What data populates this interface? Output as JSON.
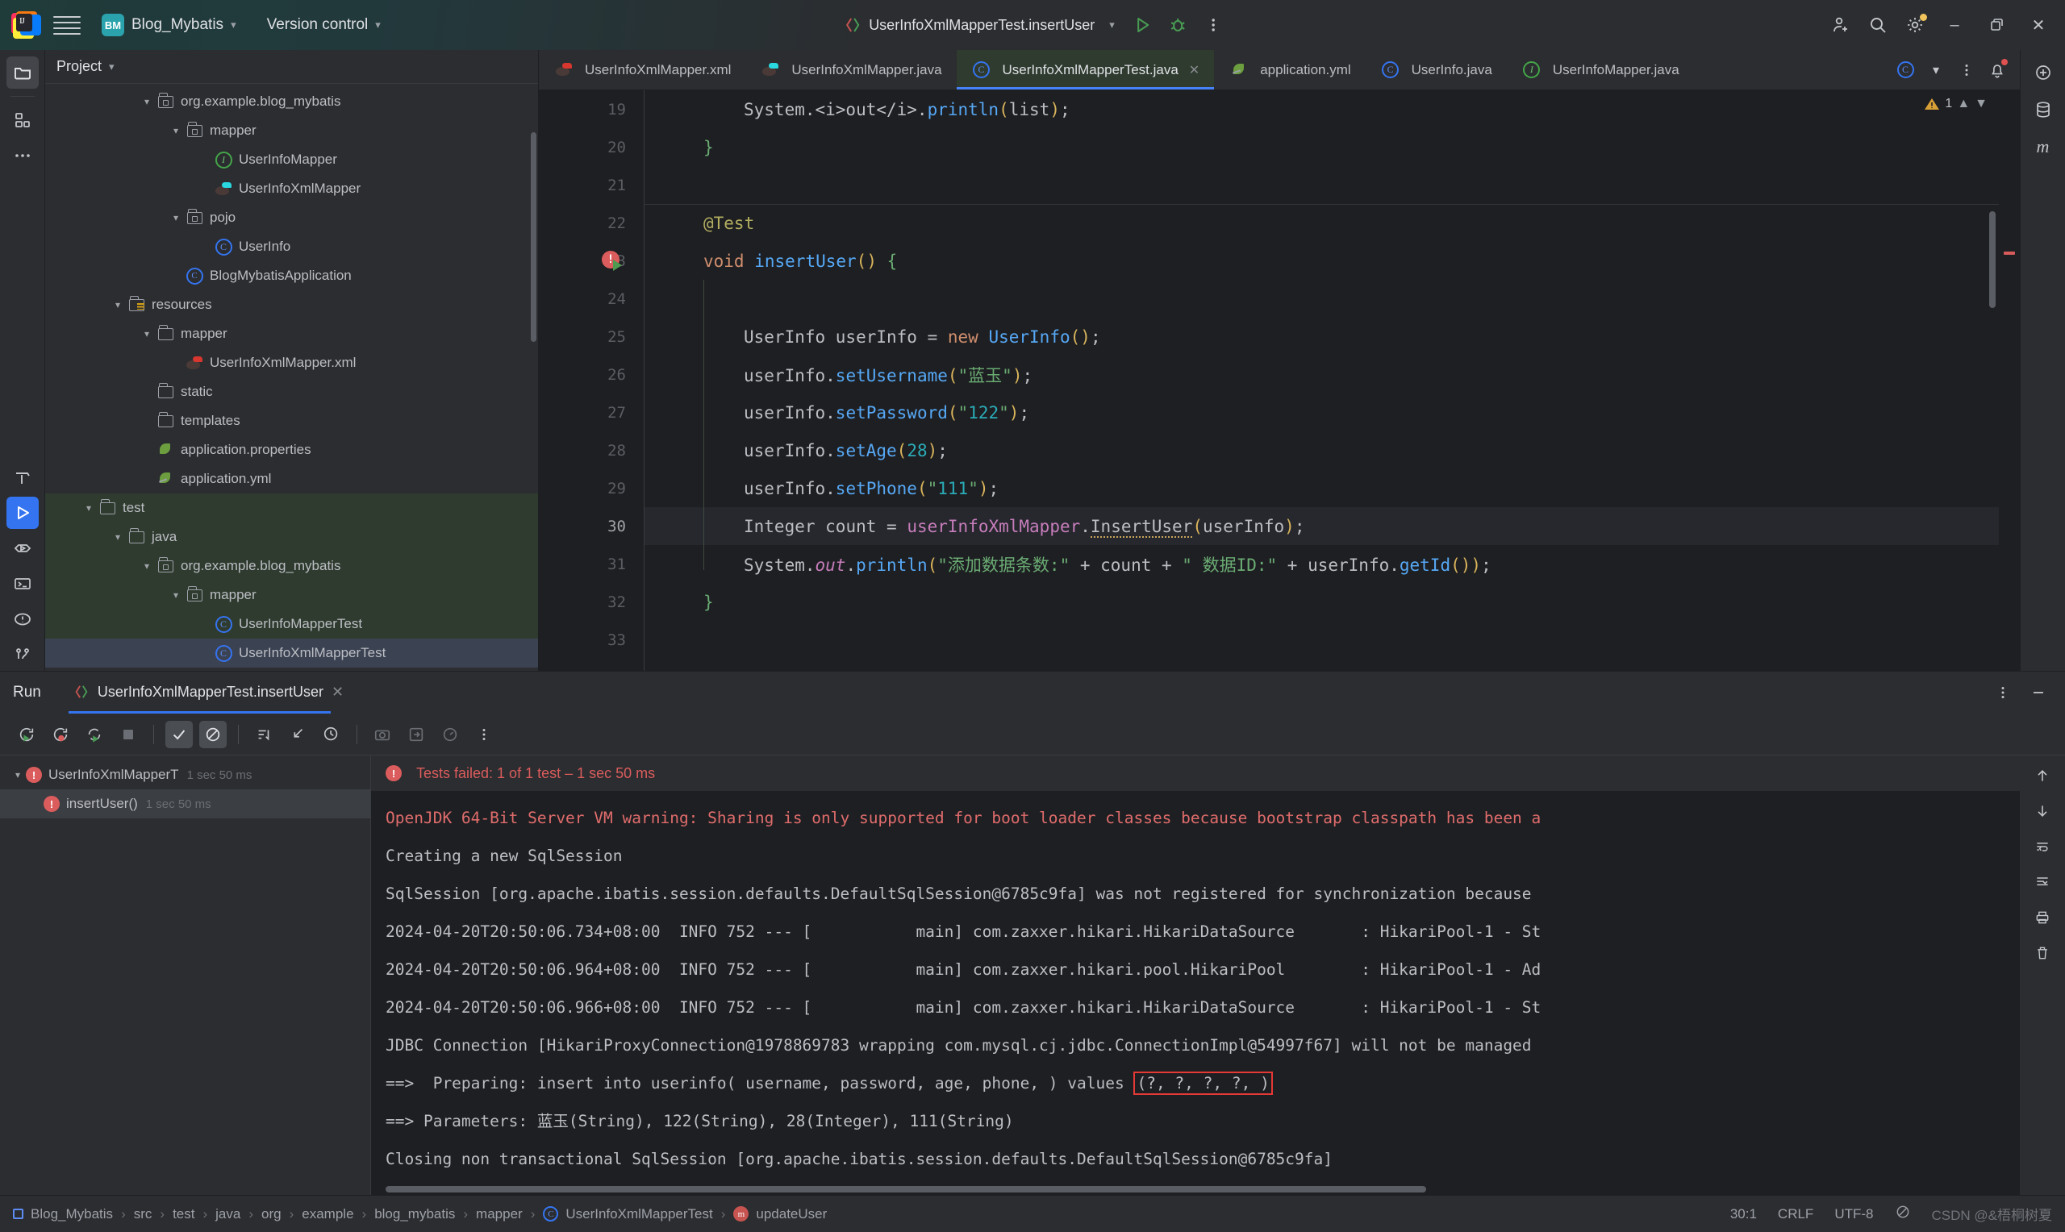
{
  "titlebar": {
    "logo_icon": "intellij-idea-logo",
    "menu_icon": "hamburger-menu-icon",
    "project_badge": "BM",
    "project_name": "Blog_Mybatis",
    "version_control": "Version control",
    "run_config": "UserInfoXmlMapperTest.insertUser",
    "run_icon": "run-icon",
    "debug_icon": "debug-icon",
    "more_icon": "more-vertical-icon",
    "account_icon": "add-account-icon",
    "search_icon": "search-icon",
    "settings_icon": "gear-icon",
    "minimize": "–",
    "maximize": "❐",
    "close": "✕"
  },
  "left_rail": [
    {
      "name": "project-tool-window",
      "icon": "folder-icon",
      "active": true
    },
    {
      "name": "structure-tool-window",
      "icon": "structure-icon",
      "active": false
    },
    {
      "name": "more-tool-windows",
      "icon": "ellipsis-icon",
      "active": false
    }
  ],
  "left_rail_bottom": [
    {
      "name": "build-tool-window",
      "icon": "hammer-icon",
      "active": false
    },
    {
      "name": "run-tool-window",
      "icon": "run-triangle-icon",
      "active": true
    },
    {
      "name": "debug-tool-window",
      "icon": "debug-eye-icon",
      "active": false
    },
    {
      "name": "terminal-tool-window",
      "icon": "terminal-icon",
      "active": false
    },
    {
      "name": "problems-tool-window",
      "icon": "warning-circle-icon",
      "active": false
    },
    {
      "name": "git-tool-window",
      "icon": "git-branch-icon",
      "active": false
    }
  ],
  "right_rail": [
    {
      "name": "ai-assistant",
      "icon": "ai-icon"
    },
    {
      "name": "database",
      "icon": "database-icon"
    },
    {
      "name": "maven",
      "icon": "maven-m-icon"
    }
  ],
  "project_panel": {
    "title": "Project",
    "tree": [
      {
        "depth": 3,
        "arrow": "down",
        "icon": "package-folder-icon",
        "label": "org.example.blog_mybatis",
        "kind": "folder"
      },
      {
        "depth": 4,
        "arrow": "down",
        "icon": "package-folder-icon",
        "label": "mapper",
        "kind": "folder"
      },
      {
        "depth": 5,
        "arrow": "none",
        "icon": "interface-icon",
        "label": "UserInfoMapper",
        "kind": "interface"
      },
      {
        "depth": 5,
        "arrow": "none",
        "icon": "mybatis-icon-cyan",
        "label": "UserInfoXmlMapper",
        "kind": "mybatis"
      },
      {
        "depth": 4,
        "arrow": "down",
        "icon": "package-folder-icon",
        "label": "pojo",
        "kind": "folder"
      },
      {
        "depth": 5,
        "arrow": "none",
        "icon": "class-icon",
        "label": "UserInfo",
        "kind": "class"
      },
      {
        "depth": 4,
        "arrow": "none",
        "icon": "spring-boot-icon",
        "label": "BlogMybatisApplication",
        "kind": "spring"
      },
      {
        "depth": 2,
        "arrow": "down",
        "icon": "resources-folder-icon",
        "label": "resources",
        "kind": "folder"
      },
      {
        "depth": 3,
        "arrow": "down",
        "icon": "folder-icon",
        "label": "mapper",
        "kind": "folder"
      },
      {
        "depth": 4,
        "arrow": "none",
        "icon": "mybatis-icon-red",
        "label": "UserInfoXmlMapper.xml",
        "kind": "mybatis"
      },
      {
        "depth": 3,
        "arrow": "none",
        "icon": "folder-icon",
        "label": "static",
        "kind": "folder"
      },
      {
        "depth": 3,
        "arrow": "none",
        "icon": "folder-icon",
        "label": "templates",
        "kind": "folder"
      },
      {
        "depth": 3,
        "arrow": "none",
        "icon": "properties-icon",
        "label": "application.properties",
        "kind": "file"
      },
      {
        "depth": 3,
        "arrow": "none",
        "icon": "yaml-icon",
        "label": "application.yml",
        "kind": "file"
      },
      {
        "depth": 1,
        "arrow": "down",
        "icon": "folder-icon",
        "label": "test",
        "kind": "folder",
        "highlight": "green"
      },
      {
        "depth": 2,
        "arrow": "down",
        "icon": "folder-icon",
        "label": "java",
        "kind": "folder",
        "highlight": "green"
      },
      {
        "depth": 3,
        "arrow": "down",
        "icon": "package-folder-icon",
        "label": "org.example.blog_mybatis",
        "kind": "folder",
        "highlight": "green"
      },
      {
        "depth": 4,
        "arrow": "down",
        "icon": "package-folder-icon",
        "label": "mapper",
        "kind": "folder",
        "highlight": "green"
      },
      {
        "depth": 5,
        "arrow": "none",
        "icon": "class-icon",
        "label": "UserInfoMapperTest",
        "kind": "class",
        "highlight": "green"
      },
      {
        "depth": 5,
        "arrow": "none",
        "icon": "class-icon",
        "label": "UserInfoXmlMapperTest",
        "kind": "class",
        "highlight": "selected"
      }
    ]
  },
  "editor": {
    "tabs": [
      {
        "label": "UserInfoXmlMapper.xml",
        "icon": "mybatis-icon-red",
        "active": false,
        "closable": false
      },
      {
        "label": "UserInfoXmlMapper.java",
        "icon": "mybatis-icon-cyan",
        "active": false,
        "closable": false
      },
      {
        "label": "UserInfoXmlMapperTest.java",
        "icon": "class-icon",
        "active": true,
        "closable": true
      },
      {
        "label": "application.yml",
        "icon": "yaml-icon",
        "active": false,
        "closable": false
      },
      {
        "label": "UserInfo.java",
        "icon": "class-icon",
        "active": false,
        "closable": false
      },
      {
        "label": "UserInfoMapper.java",
        "icon": "interface-icon",
        "active": false,
        "closable": false
      }
    ],
    "tab_overflow_icon": "class-icon",
    "tab_chevron_icon": "chevron-down-icon",
    "tab_more_icon": "more-vertical-icon",
    "notifications_icon": "bell-icon",
    "inspection_count": "1",
    "inspection_icon": "warning-triangle-icon",
    "lines": [
      {
        "num": "19",
        "indent": 2,
        "html": "System.<i>out</i>.println(list);",
        "current": false
      },
      {
        "num": "20",
        "indent": 1,
        "html": "}",
        "current": false
      },
      {
        "num": "21",
        "indent": 0,
        "html": "",
        "current": false
      },
      {
        "num": "22",
        "indent": 1,
        "html": "@Test",
        "current": false
      },
      {
        "num": "23",
        "indent": 1,
        "html": "void insertUser() {",
        "current": false,
        "breakpoint": true,
        "runmark": true
      },
      {
        "num": "24",
        "indent": 0,
        "html": "",
        "current": false
      },
      {
        "num": "25",
        "indent": 2,
        "html": "UserInfo userInfo = new UserInfo();",
        "current": false
      },
      {
        "num": "26",
        "indent": 2,
        "html": "userInfo.setUsername(\"蓝玉\");",
        "current": false
      },
      {
        "num": "27",
        "indent": 2,
        "html": "userInfo.setPassword(\"122\");",
        "current": false
      },
      {
        "num": "28",
        "indent": 2,
        "html": "userInfo.setAge(28);",
        "current": false
      },
      {
        "num": "29",
        "indent": 2,
        "html": "userInfo.setPhone(\"111\");",
        "current": false
      },
      {
        "num": "30",
        "indent": 2,
        "html": "Integer count = userInfoXmlMapper.InsertUser(userInfo);",
        "current": true
      },
      {
        "num": "31",
        "indent": 2,
        "html": "System.out.println(\"添加数据条数:\" + count + \" 数据ID:\" + userInfo.getId());",
        "current": false
      },
      {
        "num": "32",
        "indent": 1,
        "html": "}",
        "current": false
      },
      {
        "num": "33",
        "indent": 0,
        "html": "",
        "current": false
      }
    ]
  },
  "run_panel": {
    "title": "Run",
    "tab_label": "UserInfoXmlMapperTest.insertUser",
    "tab_icon": "test-run-icon",
    "close_icon": "close-icon",
    "options_icon": "more-vertical-icon",
    "minimize_icon": "minimize-icon",
    "toolbar": [
      {
        "name": "rerun-button",
        "icon": "rerun-icon",
        "state": "normal"
      },
      {
        "name": "rerun-failed-tests-button",
        "icon": "rerun-failed-icon",
        "state": "normal"
      },
      {
        "name": "toggle-auto-test-button",
        "icon": "auto-test-icon",
        "state": "normal"
      },
      {
        "name": "stop-button",
        "icon": "stop-square-icon",
        "state": "dim"
      },
      {
        "name": "show-passed-button",
        "icon": "check-icon",
        "state": "selected"
      },
      {
        "name": "hide-ignored-button",
        "icon": "ignored-icon",
        "state": "selected"
      },
      {
        "name": "sort-by-duration-button",
        "icon": "sort-icon",
        "state": "normal"
      },
      {
        "name": "expand-collapse-button",
        "icon": "collapse-icon",
        "state": "normal"
      },
      {
        "name": "history-button",
        "icon": "clock-icon",
        "state": "normal"
      },
      {
        "name": "export-button",
        "icon": "camera-icon",
        "state": "dim"
      },
      {
        "name": "import-button",
        "icon": "import-icon",
        "state": "dim"
      },
      {
        "name": "profile-button",
        "icon": "gauge-icon",
        "state": "dim"
      },
      {
        "name": "more-options-button",
        "icon": "more-vertical-icon",
        "state": "normal"
      }
    ],
    "test_tree": [
      {
        "label": "UserInfoXmlMapperT",
        "duration": "1 sec 50 ms",
        "status": "failed",
        "depth": 0,
        "expanded": true,
        "selected": false
      },
      {
        "label": "insertUser()",
        "duration": "1 sec 50 ms",
        "status": "failed",
        "depth": 1,
        "expanded": false,
        "selected": true
      }
    ],
    "console_header": "Tests failed: 1 of 1 test – 1 sec 50 ms",
    "console_lines": [
      {
        "color": "red",
        "text": "OpenJDK 64-Bit Server VM warning: Sharing is only supported for boot loader classes because bootstrap classpath has been a"
      },
      {
        "color": "white",
        "text": "Creating a new SqlSession"
      },
      {
        "color": "white",
        "text": "SqlSession [org.apache.ibatis.session.defaults.DefaultSqlSession@6785c9fa] was not registered for synchronization because"
      },
      {
        "color": "white",
        "text": "2024-04-20T20:50:06.734+08:00  INFO 752 --- [           main] com.zaxxer.hikari.HikariDataSource       : HikariPool-1 - St"
      },
      {
        "color": "white",
        "text": "2024-04-20T20:50:06.964+08:00  INFO 752 --- [           main] com.zaxxer.hikari.pool.HikariPool        : HikariPool-1 - Ad"
      },
      {
        "color": "white",
        "text": "2024-04-20T20:50:06.966+08:00  INFO 752 --- [           main] com.zaxxer.hikari.HikariDataSource       : HikariPool-1 - St"
      },
      {
        "color": "white",
        "text": "JDBC Connection [HikariProxyConnection@1978869783 wrapping com.mysql.cj.jdbc.ConnectionImpl@54997f67] will not be managed"
      },
      {
        "color": "white",
        "text": "==>  Preparing: insert into userinfo( username, password, age, phone, ) values ",
        "boxed": "(?, ?, ?, ?, )"
      },
      {
        "color": "white",
        "text": "==> Parameters: 蓝玉(String), 122(String), 28(Integer), 111(String)"
      },
      {
        "color": "white",
        "text": "Closing non transactional SqlSession [org.apache.ibatis.session.defaults.DefaultSqlSession@6785c9fa]"
      }
    ],
    "console_rail": [
      {
        "name": "scroll-up-button",
        "icon": "arrow-up-icon"
      },
      {
        "name": "scroll-down-button",
        "icon": "arrow-down-icon"
      },
      {
        "name": "soft-wrap-button",
        "icon": "wrap-icon"
      },
      {
        "name": "scroll-to-end-button",
        "icon": "scroll-end-icon"
      },
      {
        "name": "print-button",
        "icon": "printer-icon"
      },
      {
        "name": "clear-all-button",
        "icon": "trash-icon"
      }
    ]
  },
  "status_bar": {
    "breadcrumbs": [
      {
        "label": "Blog_Mybatis",
        "icon": "module-icon"
      },
      {
        "label": "src",
        "icon": null
      },
      {
        "label": "test",
        "icon": null
      },
      {
        "label": "java",
        "icon": null
      },
      {
        "label": "org",
        "icon": null
      },
      {
        "label": "example",
        "icon": null
      },
      {
        "label": "blog_mybatis",
        "icon": null
      },
      {
        "label": "mapper",
        "icon": null
      },
      {
        "label": "UserInfoXmlMapperTest",
        "icon": "class-icon"
      },
      {
        "label": "updateUser",
        "icon": "method-icon"
      }
    ],
    "caret_position": "30:1",
    "line_separator": "CRLF",
    "encoding": "UTF-8",
    "inspection_icon": "inspections-off-icon",
    "watermark": "CSDN @&梧桐树夏"
  },
  "colors": {
    "accent": "#3574f0",
    "error": "#db5c5c",
    "green_tab": "#2f3b2f",
    "bg": "#2b2d30",
    "editor_bg": "#1e1f22",
    "redbox": "#e53935"
  }
}
